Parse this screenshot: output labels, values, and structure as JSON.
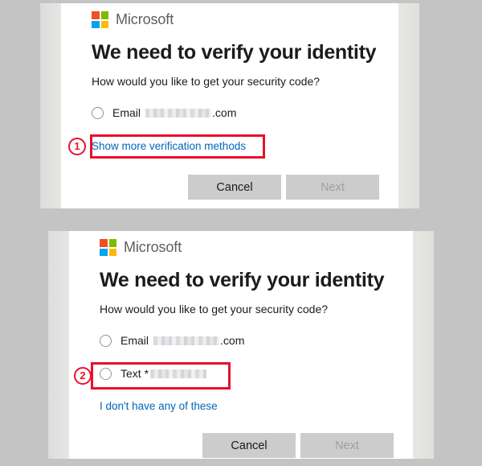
{
  "background_color": "#c4c4c4",
  "accent_link_color": "#0067b8",
  "annotation_color": "#e8112d",
  "brand": {
    "name": "Microsoft",
    "logo_colors": {
      "top_left": "#f25022",
      "top_right": "#7fba00",
      "bottom_left": "#00a4ef",
      "bottom_right": "#ffb900"
    }
  },
  "panels": [
    {
      "id": "panel-1",
      "heading": "We need to verify your identity",
      "subheading": "How would you like to get your security code?",
      "options": [
        {
          "label": "Email",
          "redacted": true,
          "suffix": ".com",
          "selected": false
        }
      ],
      "link": "Show more verification methods",
      "buttons": {
        "cancel": "Cancel",
        "next": "Next",
        "next_disabled": true
      },
      "annotation": {
        "number": "1",
        "target": "Show more verification methods"
      }
    },
    {
      "id": "panel-2",
      "heading": "We need to verify your identity",
      "subheading": "How would you like to get your security code?",
      "options": [
        {
          "label": "Email",
          "redacted": true,
          "suffix": ".com",
          "selected": false
        },
        {
          "label": "Text *",
          "redacted": true,
          "suffix": "",
          "selected": false
        }
      ],
      "link": "I don't have any of these",
      "buttons": {
        "cancel": "Cancel",
        "next": "Next",
        "next_disabled": true
      },
      "annotation": {
        "number": "2",
        "target": "Text *"
      }
    }
  ]
}
